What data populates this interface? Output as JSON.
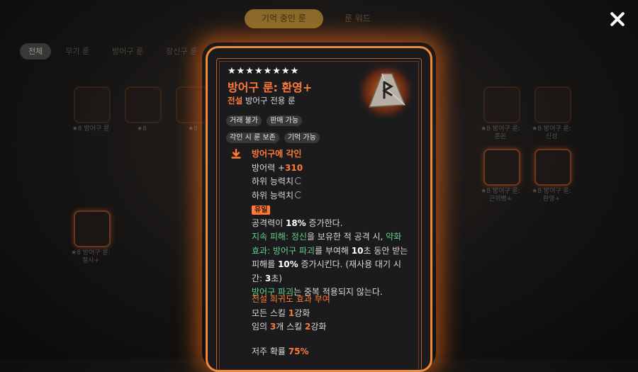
{
  "top_tabs": [
    "기억 중인 룬",
    "룬 워드"
  ],
  "filters": [
    "전체",
    "무기 룬",
    "방어구 룬",
    "장신구 룬"
  ],
  "grid_items": [
    {
      "label": "★8 방어구 룬",
      "highlight": false
    },
    {
      "label": "★8",
      "highlight": false
    },
    {
      "label": "★8",
      "highlight": false
    },
    {
      "label": "★8 방어구 룬: 환영+",
      "highlight": true
    },
    {
      "label": "★8 방어구 룬: 혼돈",
      "highlight": false
    },
    {
      "label": "★8 방어구 룬: 신성",
      "highlight": false
    },
    {
      "label": "★8 방어구 룬: 근위병+",
      "highlight": true
    },
    {
      "label": "★8 방어구 룬: 철사+",
      "highlight": true
    }
  ],
  "card": {
    "stars": "★★★★★★★★",
    "title": "방어구 룬: 환영+",
    "grade": "전설",
    "type": "방어구 전용 룬",
    "tags": [
      "거래 불가",
      "판매 가능",
      "각인 시 룬 보존",
      "기억 가능"
    ],
    "engrave_heading": "방어구에 각인",
    "defense_label": "방어력 +",
    "defense_value": "310",
    "sub_stat_1": "하위 능력치",
    "sub_stat_2": "하위 능력치",
    "unique_badge": "유일",
    "effect_p1": "공격력이 ",
    "effect_p1_val": "18%",
    "effect_p1_end": " 증가한다.",
    "dot_label": "지속 피해: ",
    "dot_text": "정신",
    "dot_mid": "을 보유한 적 공격 시, ",
    "weak_text": "약화 효과: ",
    "armor_break": "방어구 파괴",
    "effect_mid": "를 부여해 ",
    "sec_val": "10",
    "sec_mid": "초 동안 받는 피해를 ",
    "dmg_val": "10%",
    "dmg_end": " 증가시킨다. (재사용 대기 시간: ",
    "cd_val": "3",
    "cd_end": "초)",
    "nonstack_a": "방어구 파괴",
    "nonstack_b": "는 중복 적용되지 않는다.",
    "rarity_heading": "전설 희귀도 효과 부여",
    "all_skill_a": "모든 스킬 ",
    "all_skill_val": "1",
    "all_skill_b": "강화",
    "random_a": "임의 ",
    "random_val": "3",
    "random_b": "개 스킬 ",
    "random_val2": "2",
    "random_c": "강화",
    "curse_label": "저주 확률 ",
    "curse_val": "75%"
  },
  "colors": {
    "accent": "#ff7a36",
    "green": "#62d18a",
    "frame": "#f08a3a"
  }
}
